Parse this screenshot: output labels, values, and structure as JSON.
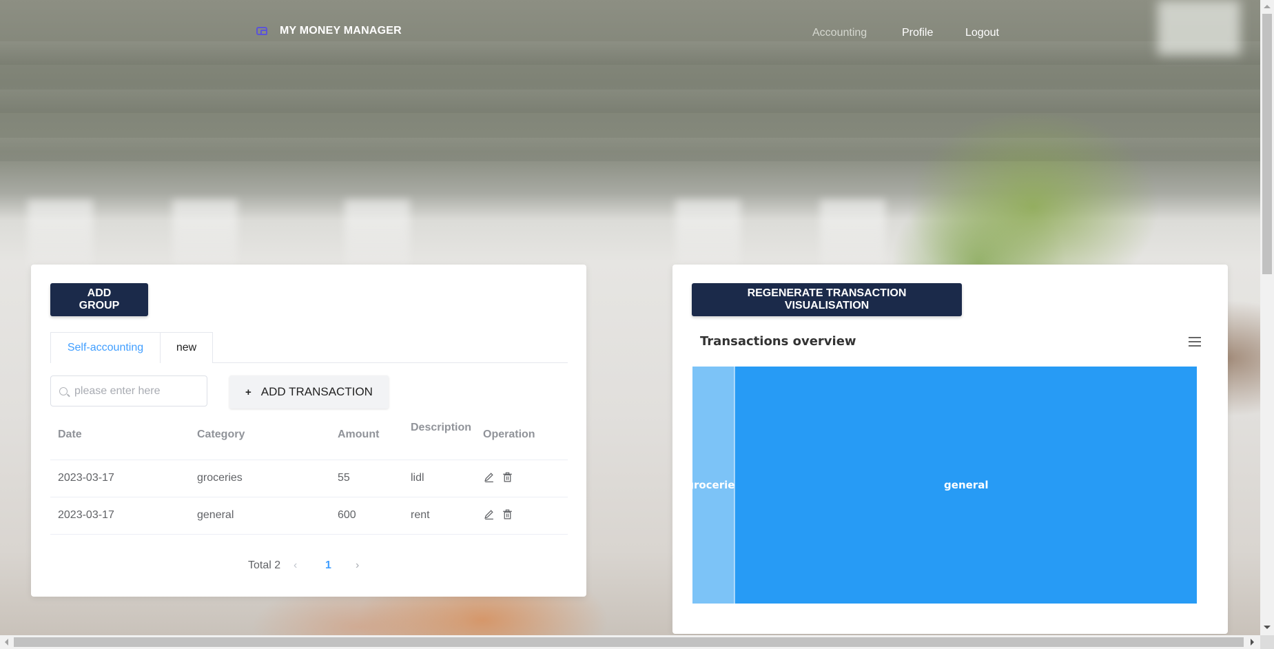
{
  "header": {
    "brand": "MY MONEY MANAGER",
    "nav": [
      {
        "label": "Accounting",
        "active": true
      },
      {
        "label": "Profile",
        "active": false
      },
      {
        "label": "Logout",
        "active": false
      }
    ]
  },
  "left_card": {
    "add_group_label": "ADD GROUP",
    "tabs": [
      {
        "label": "Self-accounting",
        "active": true
      },
      {
        "label": "new",
        "active": false
      }
    ],
    "search": {
      "placeholder": "please enter here",
      "value": ""
    },
    "add_transaction_label": "ADD TRANSACTION",
    "table": {
      "columns": [
        "Date",
        "Category",
        "Amount",
        "Description",
        "Operation"
      ],
      "rows": [
        {
          "date": "2023-03-17",
          "category": "groceries",
          "amount": "55",
          "description": "lidl"
        },
        {
          "date": "2023-03-17",
          "category": "general",
          "amount": "600",
          "description": "rent"
        }
      ]
    },
    "pagination": {
      "total_label": "Total 2",
      "current_page": "1"
    }
  },
  "right_card": {
    "regenerate_label": "REGENERATE TRANSACTION VISUALISATION",
    "chart_title": "Transactions overview"
  },
  "chart_data": {
    "type": "treemap",
    "title": "Transactions overview",
    "categories": [
      "groceries",
      "general"
    ],
    "values": [
      55,
      600
    ],
    "colors": [
      "#7cc3f7",
      "#279bf5"
    ]
  },
  "colors": {
    "primary_button": "#1b2a4a",
    "accent": "#409eff",
    "brand_icon": "#5b54d8"
  },
  "icons": {
    "brand": "wallet-icon",
    "search": "search-icon",
    "edit": "edit-icon",
    "delete": "trash-icon",
    "chart_menu": "menu-icon"
  }
}
